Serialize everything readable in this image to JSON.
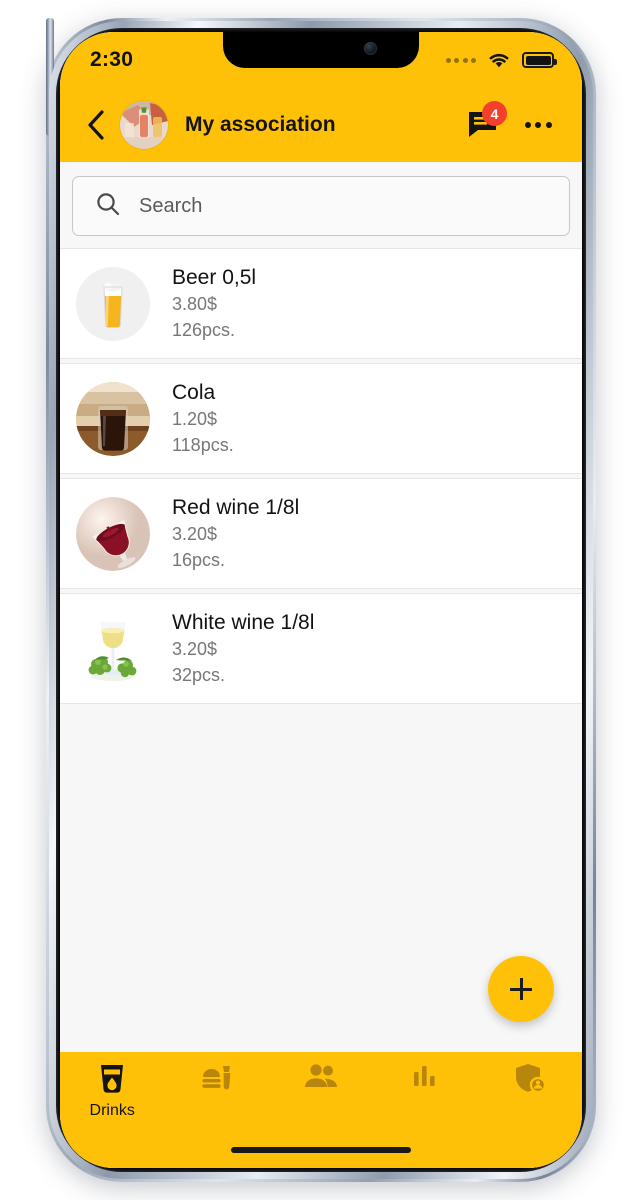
{
  "theme": {
    "accent": "#FFC107",
    "accent_dark": "#B8860B",
    "badge": "#F4402B",
    "text": "#121212",
    "muted": "#777777"
  },
  "status_bar": {
    "time": "2:30",
    "signal_icon": "signal-dots-icon",
    "wifi_icon": "wifi-icon",
    "battery_icon": "battery-full-icon"
  },
  "app_bar": {
    "back_icon": "back-chevron-icon",
    "avatar": "group-toast-photo",
    "title": "My association",
    "chat_icon": "chat-bubble-icon",
    "chat_badge": "4",
    "overflow_icon": "more-options-icon"
  },
  "search": {
    "value": "",
    "placeholder": "Search",
    "icon": "search-icon"
  },
  "items": [
    {
      "name": "Beer 0,5l",
      "price": "3.80$",
      "qty": "126pcs.",
      "icon": "beer-glass-image"
    },
    {
      "name": "Cola",
      "price": "1.20$",
      "qty": "118pcs.",
      "icon": "cola-glass-image"
    },
    {
      "name": "Red wine 1/8l",
      "price": "3.20$",
      "qty": "16pcs.",
      "icon": "red-wine-glass-image"
    },
    {
      "name": "White wine 1/8l",
      "price": "3.20$",
      "qty": "32pcs.",
      "icon": "white-wine-glass-image"
    }
  ],
  "fab": {
    "label": "+",
    "icon": "plus-icon"
  },
  "bottom_nav": [
    {
      "label": "Drinks",
      "icon": "drink-cup-icon",
      "active": true
    },
    {
      "label": "",
      "icon": "fast-food-icon",
      "active": false
    },
    {
      "label": "",
      "icon": "people-icon",
      "active": false
    },
    {
      "label": "",
      "icon": "bar-chart-icon",
      "active": false
    },
    {
      "label": "",
      "icon": "shield-user-icon",
      "active": false
    }
  ]
}
